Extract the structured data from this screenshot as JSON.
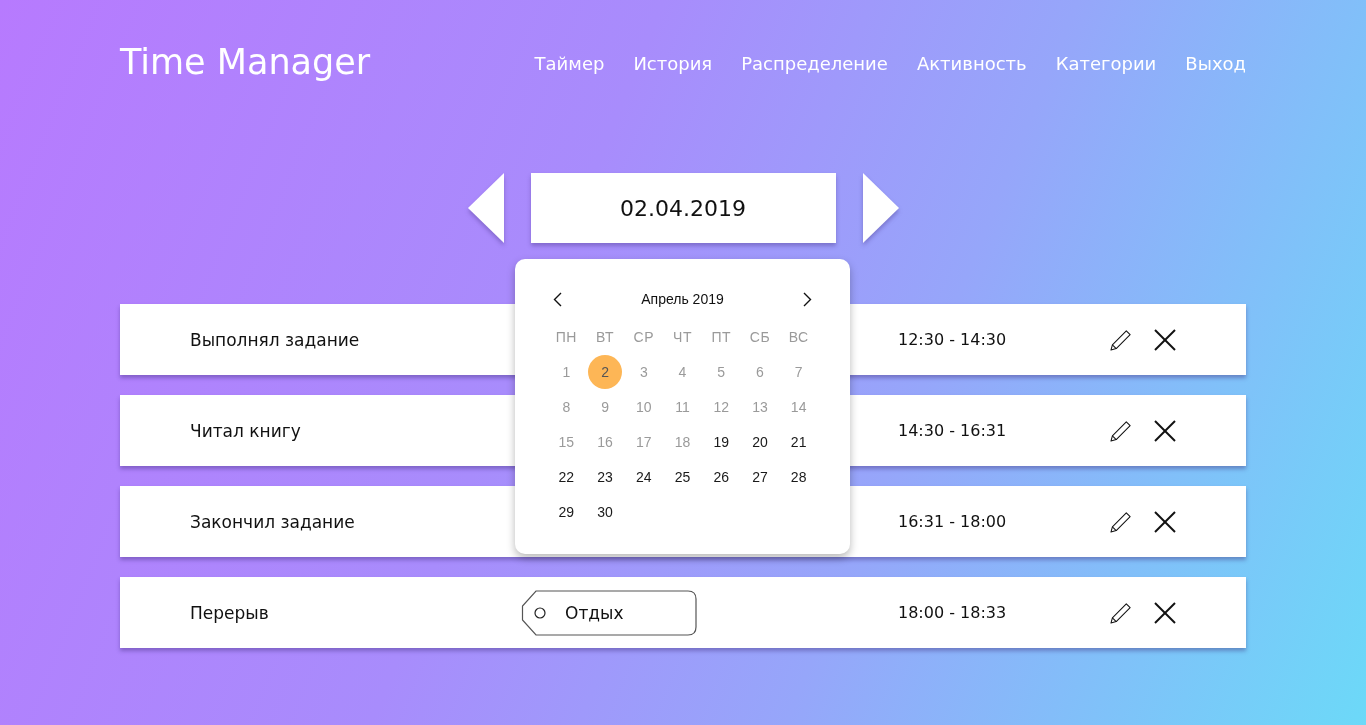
{
  "header": {
    "title": "Time Manager",
    "nav": [
      "Таймер",
      "История",
      "Распределение",
      "Активность",
      "Категории",
      "Выход"
    ]
  },
  "date_picker": {
    "value": "02.04.2019",
    "calendar": {
      "month": "Апрель 2019",
      "weekdays": [
        "ПН",
        "ВТ",
        "СР",
        "ЧТ",
        "ПТ",
        "СБ",
        "ВС"
      ],
      "days": [
        {
          "label": "1",
          "selected": false,
          "disabled": true
        },
        {
          "label": "2",
          "selected": true,
          "disabled": true
        },
        {
          "label": "3",
          "selected": false,
          "disabled": true
        },
        {
          "label": "4",
          "selected": false,
          "disabled": true
        },
        {
          "label": "5",
          "selected": false,
          "disabled": true
        },
        {
          "label": "6",
          "selected": false,
          "disabled": true
        },
        {
          "label": "7",
          "selected": false,
          "disabled": true
        },
        {
          "label": "8",
          "selected": false,
          "disabled": true
        },
        {
          "label": "9",
          "selected": false,
          "disabled": true
        },
        {
          "label": "10",
          "selected": false,
          "disabled": true
        },
        {
          "label": "11",
          "selected": false,
          "disabled": true
        },
        {
          "label": "12",
          "selected": false,
          "disabled": true
        },
        {
          "label": "13",
          "selected": false,
          "disabled": true
        },
        {
          "label": "14",
          "selected": false,
          "disabled": true
        },
        {
          "label": "15",
          "selected": false,
          "disabled": true
        },
        {
          "label": "16",
          "selected": false,
          "disabled": true
        },
        {
          "label": "17",
          "selected": false,
          "disabled": true
        },
        {
          "label": "18",
          "selected": false,
          "disabled": true
        },
        {
          "label": "19",
          "selected": false,
          "disabled": false
        },
        {
          "label": "20",
          "selected": false,
          "disabled": false
        },
        {
          "label": "21",
          "selected": false,
          "disabled": false
        },
        {
          "label": "22",
          "selected": false,
          "disabled": false
        },
        {
          "label": "23",
          "selected": false,
          "disabled": false
        },
        {
          "label": "24",
          "selected": false,
          "disabled": false
        },
        {
          "label": "25",
          "selected": false,
          "disabled": false
        },
        {
          "label": "26",
          "selected": false,
          "disabled": false
        },
        {
          "label": "27",
          "selected": false,
          "disabled": false
        },
        {
          "label": "28",
          "selected": false,
          "disabled": false
        },
        {
          "label": "29",
          "selected": false,
          "disabled": false
        },
        {
          "label": "30",
          "selected": false,
          "disabled": false
        }
      ]
    }
  },
  "entries": [
    {
      "title": "Выполнял задание",
      "time": "12:30 - 14:30"
    },
    {
      "title": "Читал книгу",
      "time": "14:30 - 16:31"
    },
    {
      "title": "Закончил задание",
      "time": "16:31 - 18:00"
    },
    {
      "title": "Перерыв",
      "tag": "Отдых",
      "time": "18:00 - 18:33"
    }
  ]
}
